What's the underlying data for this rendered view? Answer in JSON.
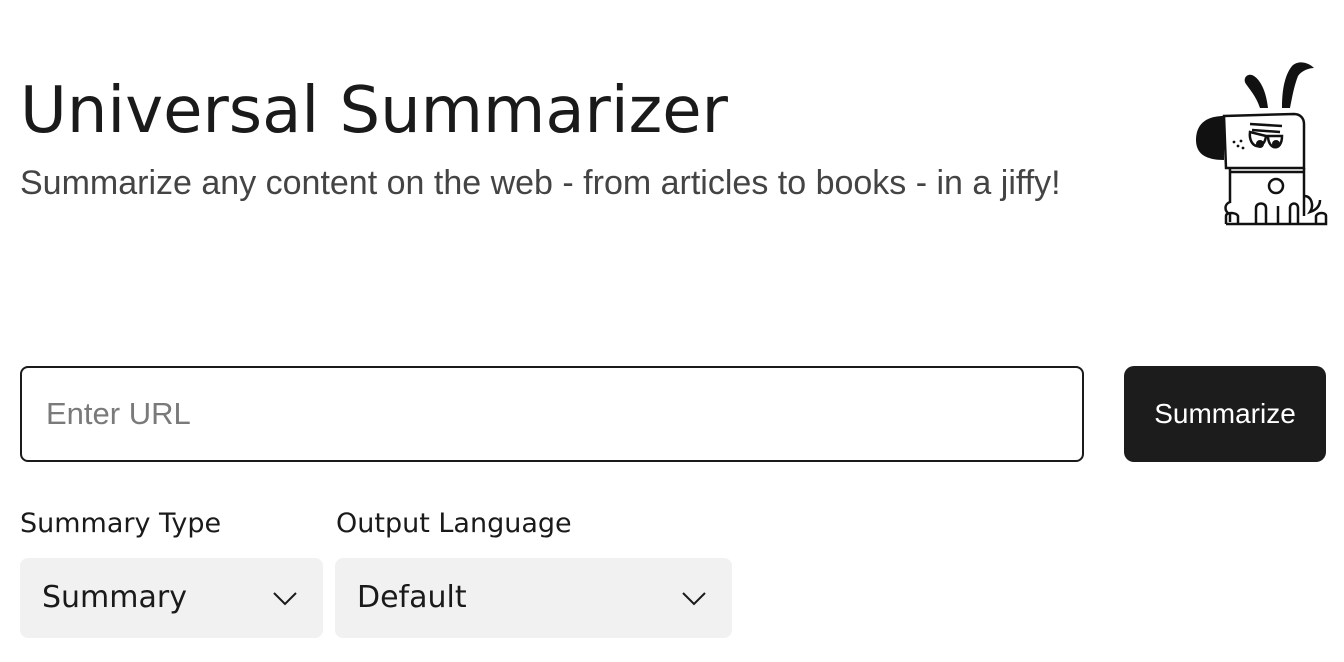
{
  "header": {
    "title": "Universal Summarizer",
    "subtitle": "Summarize any content on the web - from articles to books - in a jiffy!"
  },
  "mascot": {
    "icon": "dog-mascot-icon"
  },
  "url_form": {
    "placeholder": "Enter URL",
    "value": "",
    "submit_label": "Summarize"
  },
  "options": {
    "summary_type": {
      "label": "Summary Type",
      "selected": "Summary"
    },
    "output_language": {
      "label": "Output Language",
      "selected": "Default"
    }
  },
  "colors": {
    "text": "#1a1a1a",
    "subtitle": "#444444",
    "button_bg": "#1c1c1c",
    "select_bg": "#f1f1f1"
  }
}
